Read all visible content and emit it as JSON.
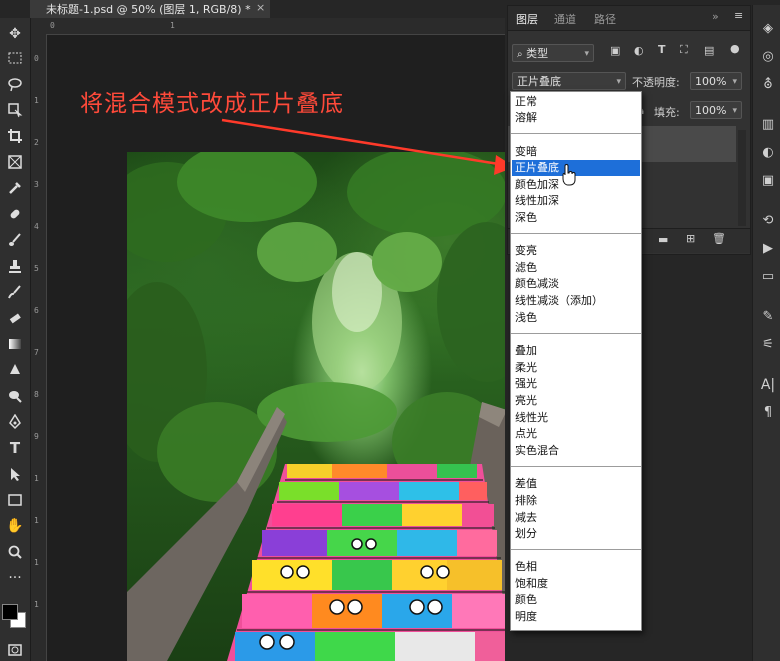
{
  "document": {
    "tab_title": "未标题-1.psd @ 50% (图层 1, RGB/8) *",
    "close": "×"
  },
  "ruler": {
    "h_ticks": [
      "0",
      "1"
    ],
    "v_ticks": [
      "0",
      "1",
      "2",
      "3",
      "4",
      "5",
      "6",
      "7",
      "8",
      "9",
      "1",
      "1",
      "1",
      "1"
    ]
  },
  "annotation": {
    "text": "将混合模式改成正片叠底",
    "color": "#ff4a3a"
  },
  "layers_panel": {
    "tabs": [
      "图层",
      "通道",
      "路径"
    ],
    "active_tab": "图层",
    "more": "»",
    "filter_label": "类型",
    "blend_mode_value": "正片叠底",
    "opacity_label": "不透明度:",
    "opacity_value": "100%",
    "fill_label": "填充:",
    "fill_value": "100%"
  },
  "blend_modes": {
    "groups": [
      [
        "正常",
        "溶解"
      ],
      [
        "变暗",
        "正片叠底",
        "颜色加深",
        "线性加深",
        "深色"
      ],
      [
        "变亮",
        "滤色",
        "颜色减淡",
        "线性减淡（添加）",
        "浅色"
      ],
      [
        "叠加",
        "柔光",
        "强光",
        "亮光",
        "线性光",
        "点光",
        "实色混合"
      ],
      [
        "差值",
        "排除",
        "减去",
        "划分"
      ],
      [
        "色相",
        "饱和度",
        "颜色",
        "明度"
      ]
    ],
    "selected": "正片叠底",
    "selection_color": "#1e6fd9"
  },
  "colors": {
    "foreground": "#000000",
    "background": "#ffffff",
    "ui_dark": "#262626",
    "panel": "#323232"
  }
}
